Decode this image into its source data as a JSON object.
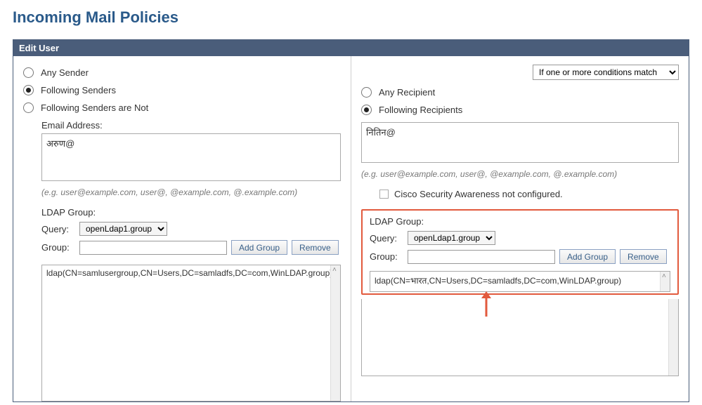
{
  "page_title": "Incoming Mail Policies",
  "panel_header": "Edit User",
  "condition_select": "If one or more conditions match",
  "left": {
    "radios": {
      "any_sender": "Any Sender",
      "following_senders": "Following Senders",
      "following_senders_not": "Following Senders are Not"
    },
    "email_label": "Email Address:",
    "email_value": "अरुण@",
    "email_hint": "(e.g. user@example.com, user@, @example.com, @.example.com)",
    "ldap_label": "LDAP Group:",
    "query_label": "Query:",
    "query_value": "openLdap1.group",
    "group_label": "Group:",
    "group_value": "",
    "add_group_btn": "Add Group",
    "remove_btn": "Remove",
    "list_entry": "ldap(CN=samlusergroup,CN=Users,DC=samladfs,DC=com,WinLDAP.group)"
  },
  "right": {
    "radios": {
      "any_recipient": "Any Recipient",
      "following_recipients": "Following Recipients"
    },
    "email_value": "नितिन@",
    "email_hint": "(e.g. user@example.com, user@, @example.com, @.example.com)",
    "awareness_text": "Cisco Security Awareness not configured.",
    "ldap_label": "LDAP Group:",
    "query_label": "Query:",
    "query_value": "openLdap1.group",
    "group_label": "Group:",
    "group_value": "",
    "add_group_btn": "Add Group",
    "remove_btn": "Remove",
    "list_entry": "ldap(CN=भारत,CN=Users,DC=samladfs,DC=com,WinLDAP.group)"
  }
}
